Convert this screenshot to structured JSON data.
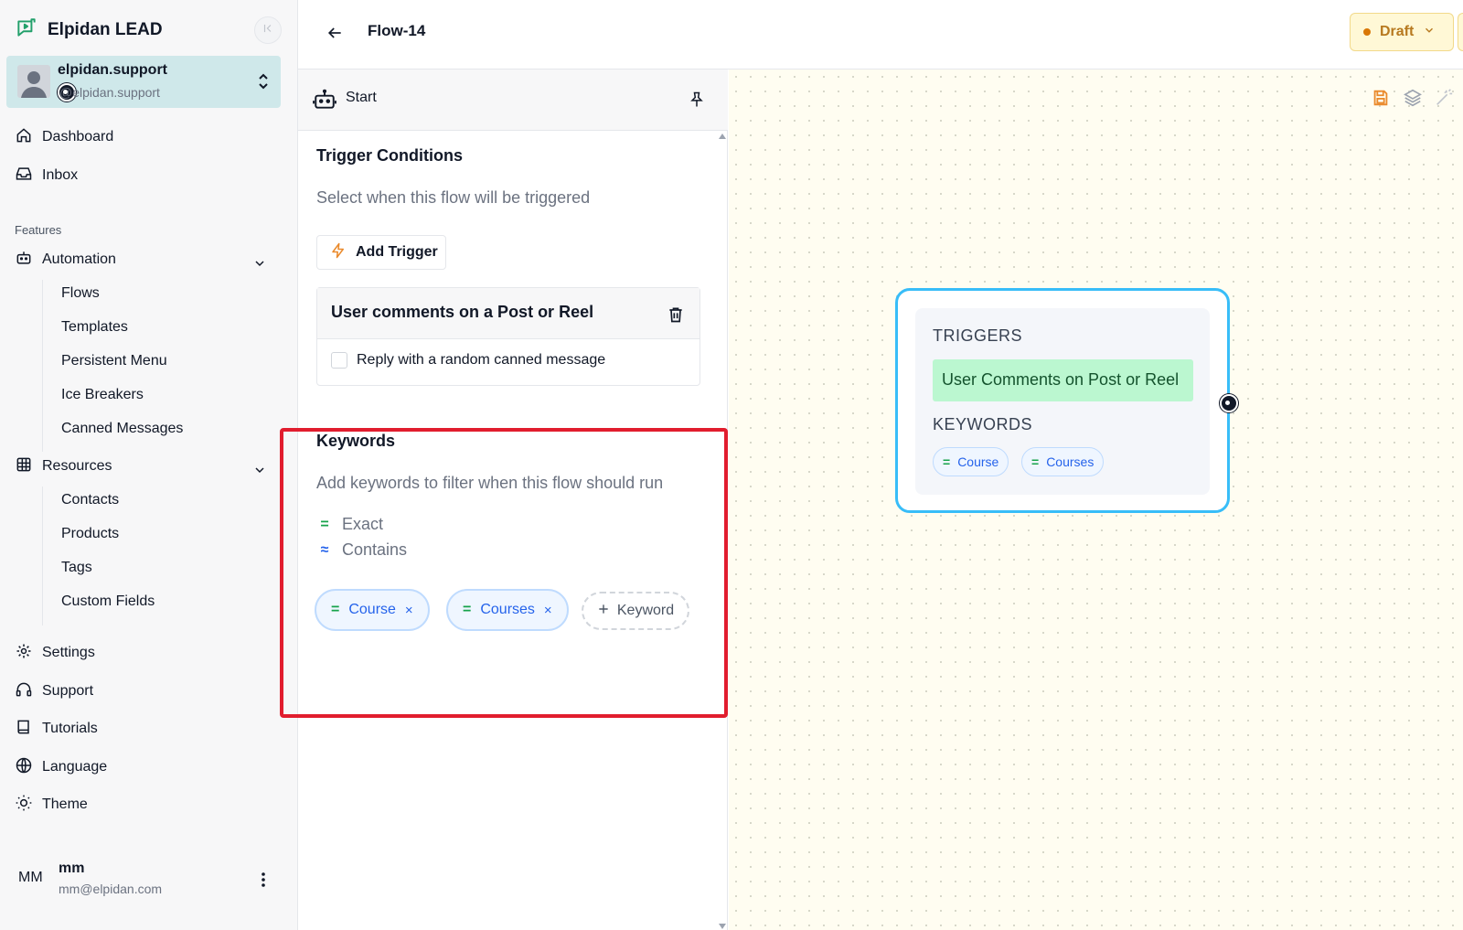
{
  "app": {
    "title": "Elpidan LEAD"
  },
  "account": {
    "name": "elpidan.support",
    "handle": "@elpidan.support"
  },
  "nav": {
    "dashboard": "Dashboard",
    "inbox": "Inbox",
    "features_label": "Features",
    "automation": {
      "label": "Automation",
      "items": [
        "Flows",
        "Templates",
        "Persistent Menu",
        "Ice Breakers",
        "Canned Messages"
      ]
    },
    "resources": {
      "label": "Resources",
      "items": [
        "Contacts",
        "Products",
        "Tags",
        "Custom Fields"
      ]
    },
    "settings": "Settings",
    "support": "Support",
    "tutorials": "Tutorials",
    "language": "Language",
    "theme": "Theme"
  },
  "user": {
    "initials": "MM",
    "name": "mm",
    "email": "mm@elpidan.com"
  },
  "topbar": {
    "flow_title": "Flow-14",
    "status": "Draft"
  },
  "panel": {
    "header": "Start",
    "trigger_conditions": {
      "title": "Trigger Conditions",
      "subtitle": "Select when this flow will be triggered",
      "add_button": "Add Trigger",
      "card_title": "User comments on a Post or Reel",
      "checkbox_label": "Reply with a random canned message",
      "checkbox_checked": false
    },
    "keywords": {
      "title": "Keywords",
      "subtitle": "Add keywords to filter when this flow should run",
      "legend": [
        {
          "symbol": "=",
          "label": "Exact"
        },
        {
          "symbol": "≈",
          "label": "Contains"
        }
      ],
      "chips": [
        {
          "symbol": "=",
          "label": "Course",
          "remove": "×"
        },
        {
          "symbol": "=",
          "label": "Courses",
          "remove": "×"
        }
      ],
      "add_label": "Keyword"
    }
  },
  "canvas": {
    "node": {
      "triggers_label": "TRIGGERS",
      "trigger": "User Comments on Post or Reel",
      "keywords_label": "KEYWORDS",
      "keywords": [
        {
          "symbol": "=",
          "label": "Course"
        },
        {
          "symbol": "=",
          "label": "Courses"
        }
      ]
    }
  },
  "colors": {
    "accent": "#38bdf8",
    "highlight": "#e11d2e",
    "draft": "#b7791f",
    "trigger_bg": "#bbf7d0",
    "keyword_chip": "#2563eb",
    "account_bg": "#cfe8ea"
  },
  "icons": {
    "brand": "chat-bot-icon",
    "collapse": "collapse-left-icon",
    "switch": "chevron-up-down-icon",
    "dashboard": "home-icon",
    "inbox": "inbox-icon",
    "automation": "bot-icon",
    "resources": "grid-icon",
    "settings": "gear-icon",
    "support": "headset-icon",
    "tutorials": "book-icon",
    "language": "globe-icon",
    "theme": "sun-icon",
    "pin": "pin-icon",
    "trash": "trash-icon",
    "bolt": "bolt-icon",
    "save": "save-icon",
    "layers": "layers-icon",
    "wand": "wand-icon"
  }
}
